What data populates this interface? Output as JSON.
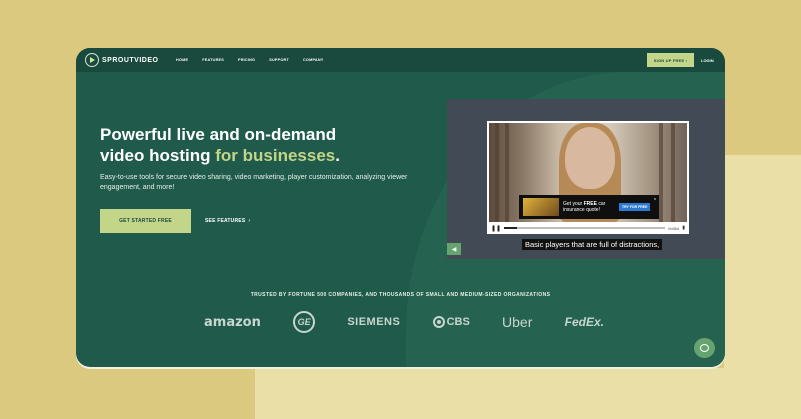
{
  "brand": {
    "name": "SPROUTVIDEO"
  },
  "nav": {
    "links": [
      "HOME",
      "FEATURES",
      "PRICING",
      "SUPPORT",
      "COMPANY"
    ],
    "signup": "SIGN UP FREE",
    "login": "LOGIN"
  },
  "hero": {
    "headline_part1": "Powerful live and on-demand video hosting",
    "headline_accent": "for businesses",
    "headline_end": ".",
    "subtext": "Easy-to-use tools for secure video sharing, video marketing, player customization, analyzing viewer engagement, and more!",
    "cta": "GET STARTED FREE",
    "see_features": "SEE FEATURES"
  },
  "player": {
    "ad_text_prefix": "Get your",
    "ad_text_free": "FREE",
    "ad_text_suffix": "car insurance quote!",
    "ad_button": "TRY FOR FREE",
    "ad_close": "x",
    "player_brand": "VidBid",
    "caption": "Basic players that are full of distractions,",
    "progress": 0.08
  },
  "trusted": {
    "title": "TRUSTED BY FORTUNE 500 COMPANIES, AND THOUSANDS OF SMALL AND MEDIUM-SIZED ORGANIZATIONS",
    "logos": [
      "amazon",
      "GE",
      "SIEMENS",
      "CBS",
      "Uber",
      "FedEx."
    ]
  },
  "colors": {
    "page_bg": "#dac97f",
    "page_bg_light": "#eadfa6",
    "window_bg": "#1f5a4b",
    "nav_bg": "#1a4a3e",
    "accent": "#c3d589",
    "chat": "#65a46f"
  },
  "icons": [
    "logo-play-icon",
    "chevron-right-icon",
    "pause-icon",
    "volume-icon",
    "mute-icon",
    "chat-icon",
    "close-icon"
  ]
}
